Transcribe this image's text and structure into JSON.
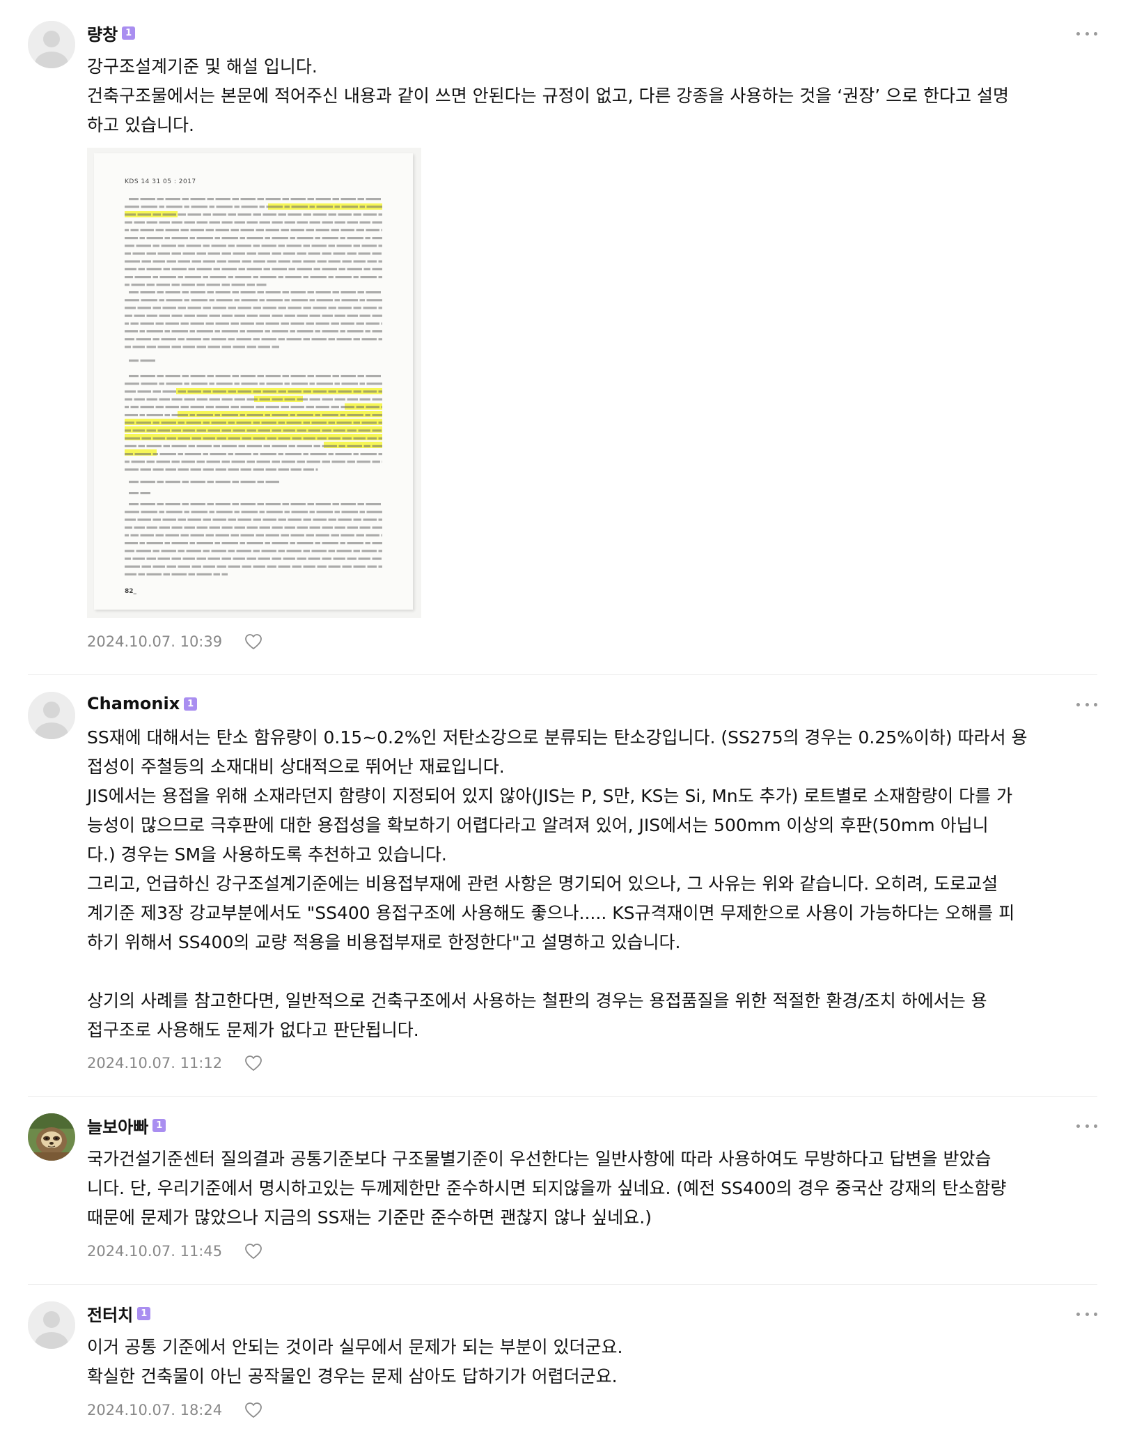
{
  "comments": [
    {
      "author": "량창",
      "level": "1",
      "avatar": "default-avatar",
      "lines": [
        "강구조설계기준 및 해설 입니다.",
        "건축구조물에서는 본문에 적어주신 내용과 같이 쓰면 안된다는 규정이 없고, 다른 강종을 사용하는 것을 ‘권장’ 으로 한다고 설명",
        "하고 있습니다."
      ],
      "date": "2024.10.07. 10:39",
      "attachment": {
        "header": "KDS 14 31 05 : 2017",
        "page_number": "82_",
        "highlight_color": "#f5f53a"
      }
    },
    {
      "author": "Chamonix",
      "level": "1",
      "avatar": "default-avatar",
      "lines": [
        "SS재에 대해서는 탄소 함유량이 0.15~0.2%인 저탄소강으로 분류되는 탄소강입니다. (SS275의 경우는 0.25%이하) 따라서 용",
        "접성이 주철등의 소재대비 상대적으로 뛰어난 재료입니다.",
        "JIS에서는 용접을 위해 소재라던지 함량이 지정되어 있지 않아(JIS는 P, S만, KS는 Si, Mn도 추가) 로트별로 소재함량이 다를 가",
        "능성이 많으므로 극후판에 대한 용접성을 확보하기 어렵다라고 알려져 있어, JIS에서는 500mm 이상의 후판(50mm 아닙니",
        "다.) 경우는 SM을 사용하도록 추천하고 있습니다.",
        "그리고, 언급하신 강구조설계기준에는 비용접부재에 관련 사항은 명기되어 있으나, 그 사유는 위와 같습니다. 오히려, 도로교설",
        "계기준 제3장 강교부분에서도 \"SS400 용접구조에 사용해도 좋으나..... KS규격재이면 무제한으로 사용이 가능하다는 오해를 피",
        "하기 위해서 SS400의 교량 적용을 비용접부재로 한정한다\"고 설명하고 있습니다.",
        "",
        "상기의 사례를 참고한다면, 일반적으로 건축구조에서 사용하는 철판의 경우는 용접품질을 위한 적절한 환경/조치 하에서는 용",
        "접구조로 사용해도 문제가 없다고 판단됩니다."
      ],
      "date": "2024.10.07. 11:12"
    },
    {
      "author": "늘보아빠",
      "level": "1",
      "avatar": "sloth-avatar",
      "lines": [
        "국가건설기준센터 질의결과 공통기준보다 구조물별기준이 우선한다는 일반사항에 따라 사용하여도 무방하다고 답변을 받았습",
        "니다. 단, 우리기준에서 명시하고있는 두께제한만 준수하시면 되지않을까 싶네요. (예전 SS400의 경우 중국산 강재의 탄소함량",
        "때문에 문제가 많았으나 지금의 SS재는 기준만 준수하면 괜찮지 않나 싶네요.)"
      ],
      "date": "2024.10.07. 11:45"
    },
    {
      "author": "전터치",
      "level": "1",
      "avatar": "default-avatar",
      "lines": [
        "이거 공통 기준에서 안되는 것이라 실무에서 문제가 되는 부분이 있더군요.",
        "확실한 건축물이 아닌 공작물인 경우는 문제 삼아도 답하기가 어렵더군요."
      ],
      "date": "2024.10.07. 18:24"
    }
  ],
  "icons": {
    "more": "more-vertical-dots-icon",
    "like": "heart-outline-icon"
  }
}
